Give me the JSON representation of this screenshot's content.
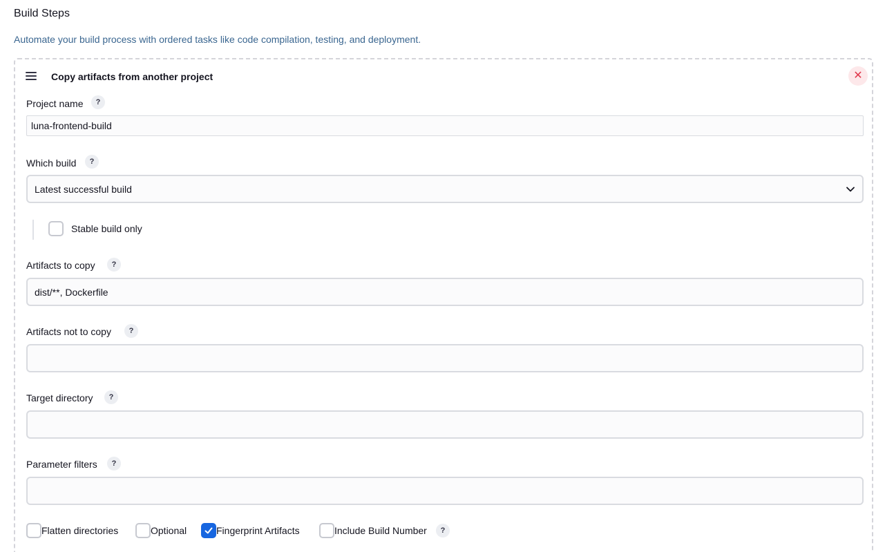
{
  "section": {
    "title": "Build Steps",
    "description": "Automate your build process with ordered tasks like code compilation, testing, and deployment."
  },
  "step": {
    "title": "Copy artifacts from another project",
    "close_label": "✕",
    "help_label": "?",
    "project_name": {
      "label": "Project name",
      "value": "luna-frontend-build"
    },
    "which_build": {
      "label": "Which build",
      "selected": "Latest successful build"
    },
    "stable_build_only": {
      "label": "Stable build only",
      "checked": false
    },
    "artifacts_to_copy": {
      "label": "Artifacts to copy",
      "value": "dist/**, Dockerfile"
    },
    "artifacts_not_to_copy": {
      "label": "Artifacts not to copy",
      "value": ""
    },
    "target_directory": {
      "label": "Target directory",
      "value": ""
    },
    "parameter_filters": {
      "label": "Parameter filters",
      "value": ""
    },
    "options": [
      {
        "label": "Flatten directories",
        "checked": false
      },
      {
        "label": "Optional",
        "checked": false
      },
      {
        "label": "Fingerprint Artifacts",
        "checked": true
      },
      {
        "label": "Include Build Number",
        "checked": false
      }
    ]
  },
  "icons": {
    "drag": "drag-handle-icon",
    "close": "close-icon",
    "help": "help-icon",
    "chevron": "chevron-down-icon",
    "check": "checkmark-icon"
  },
  "colors": {
    "accent": "#1766e0",
    "description_text": "#3a6690",
    "danger": "#e0374b",
    "danger_bg": "#fde8ea"
  }
}
